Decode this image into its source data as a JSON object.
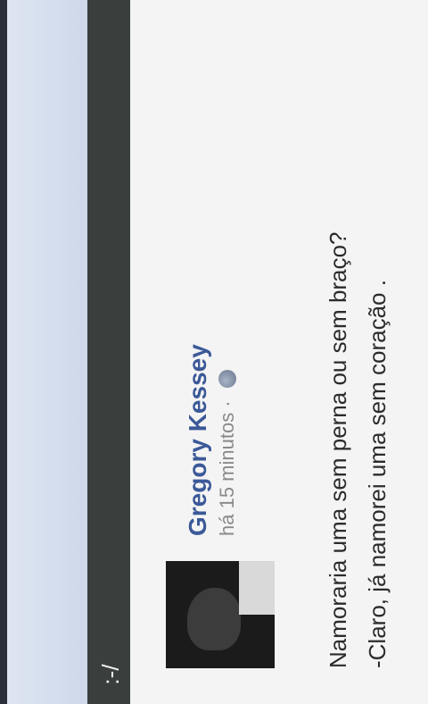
{
  "app_bar": {
    "label": ":-/"
  },
  "post": {
    "author": "Gregory Kessey",
    "time": "há 15 minutos ·",
    "visibility_icon": "globe-icon",
    "text_line_1": "Namoraria uma sem perna ou sem braço?",
    "text_line_2": "-Claro, já namorei uma sem coração ."
  },
  "colors": {
    "author": "#3b5998",
    "app_bar": "#3a3f3e"
  }
}
